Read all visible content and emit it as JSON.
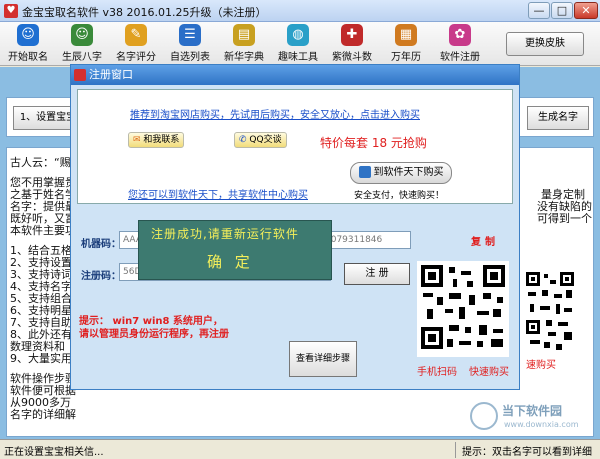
{
  "window": {
    "title": "金宝宝取名软件 v38  2016.01.25升级（未注册）",
    "min": "—",
    "max": "□",
    "close": "✕"
  },
  "toolbar": {
    "items": [
      {
        "label": "开始取名",
        "icon": "user-icon",
        "color": "#1f6fd1"
      },
      {
        "label": "生辰八字",
        "icon": "user-icon",
        "color": "#3a8a3a"
      },
      {
        "label": "名字评分",
        "icon": "doc-icon",
        "color": "#e0a020"
      },
      {
        "label": "自选列表",
        "icon": "list-icon",
        "color": "#2a6ec8"
      },
      {
        "label": "新华字典",
        "icon": "book-icon",
        "color": "#c8a020"
      },
      {
        "label": "趣味工具",
        "icon": "globe-icon",
        "color": "#2aa0c8"
      },
      {
        "label": "紫微斗数",
        "icon": "star-icon",
        "color": "#c02a2a"
      },
      {
        "label": "万年历",
        "icon": "calendar-icon",
        "color": "#d07a20"
      },
      {
        "label": "软件注册",
        "icon": "flower-icon",
        "color": "#c83a8a"
      }
    ],
    "skin_button": "更换皮肤"
  },
  "main": {
    "step1": "1、设置宝宝",
    "generate": "生成名字",
    "lines": [
      "古人云：“赐",
      "您不用掌握贵",
      "之基于姓名学",
      "名字：提供最",
      "既好听，又富",
      "本软件主要功",
      "1、结合五格",
      "2、支持设置",
      "3、支持诗词",
      "4、支持名字",
      "5、支持组合",
      "6、支持明星",
      "7、支持自助",
      "8、此外还有",
      "   数理资料和",
      "9、大量实用",
      "软件操作步骤",
      "软件便可根据",
      "从9000多万",
      "名字的详细解"
    ],
    "right_fragments": [
      "量身定制",
      "没有缺陷的",
      "可得到一个"
    ]
  },
  "status": {
    "left": "正在设置宝宝相关信...",
    "right": "提示：双击名字可以看到详细解释"
  },
  "dialog": {
    "title": "注册窗口",
    "link_taobao": "推荐到淘宝网店购买，先试用后购买，安全又放心，点击进入购买",
    "chat_wangwang": "和我联系",
    "chat_qq": "QQ交谈",
    "price": "特价每套 18 元抢购",
    "buy_button": "到软件天下购买",
    "safe_text": "安全支付，快速购买！",
    "link_center": "您还可以到软件天下，共享软件中心购买",
    "machine_label": "机器码：",
    "machine_value": "AAA-",
    "machine_value_tail": "1079311846",
    "copy_label": "复制",
    "reg_label": "注册码：",
    "reg_value": "56D5",
    "reg_button": "注  册",
    "tip_line1": "提示： win7 win8  系统用户，",
    "tip_line2": "请以管理员身份运行程序，再注册",
    "detail_button": "查看详细步骤",
    "qr_mobile": "手机扫码",
    "qr_fast": "快速购买"
  },
  "success": {
    "message": "注册成功,请重新运行软件",
    "ok": "确  定"
  },
  "outside": {
    "fast_buy": "速购买",
    "watermark_text": "当下软件园",
    "watermark_url": "www.downxia.com"
  }
}
